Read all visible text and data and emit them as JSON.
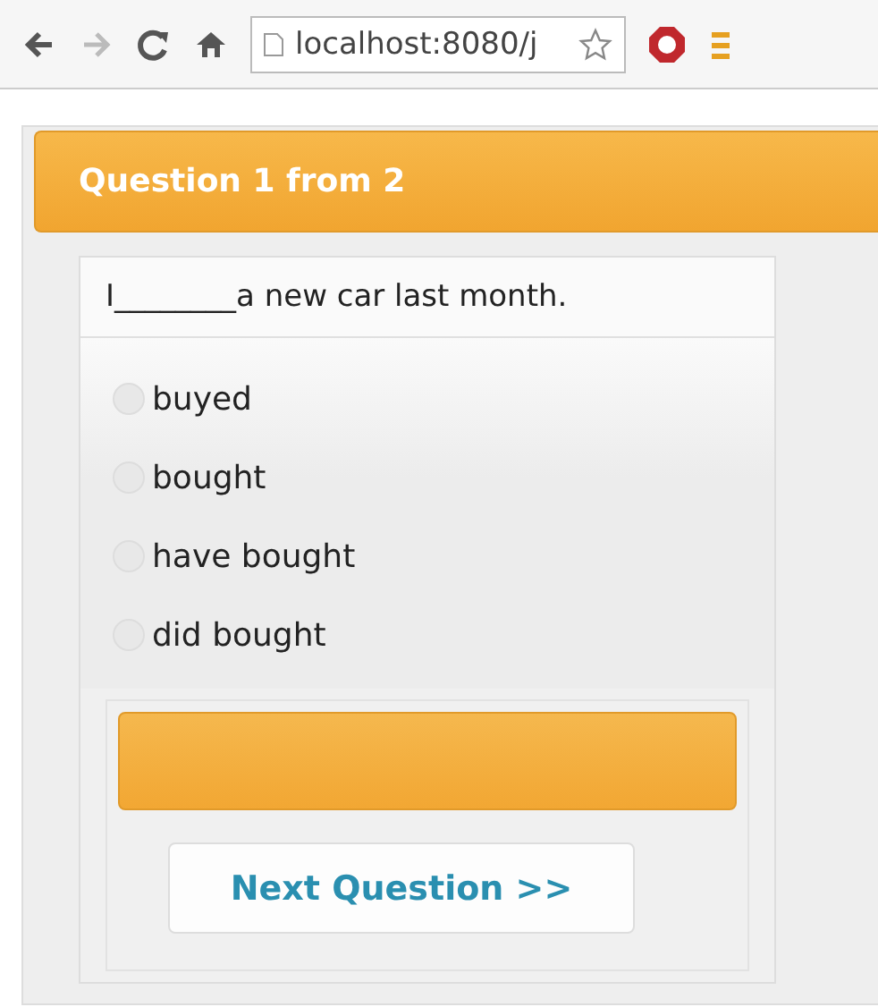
{
  "browser": {
    "url": "localhost:8080/j"
  },
  "quiz": {
    "heading": "Question 1 from 2",
    "question": "I________a new car last month.",
    "options": [
      {
        "label": "buyed",
        "selected": false
      },
      {
        "label": "bought",
        "selected": false
      },
      {
        "label": "have bought",
        "selected": false
      },
      {
        "label": "did bought",
        "selected": false
      }
    ],
    "next_button": "Next Question >>"
  }
}
